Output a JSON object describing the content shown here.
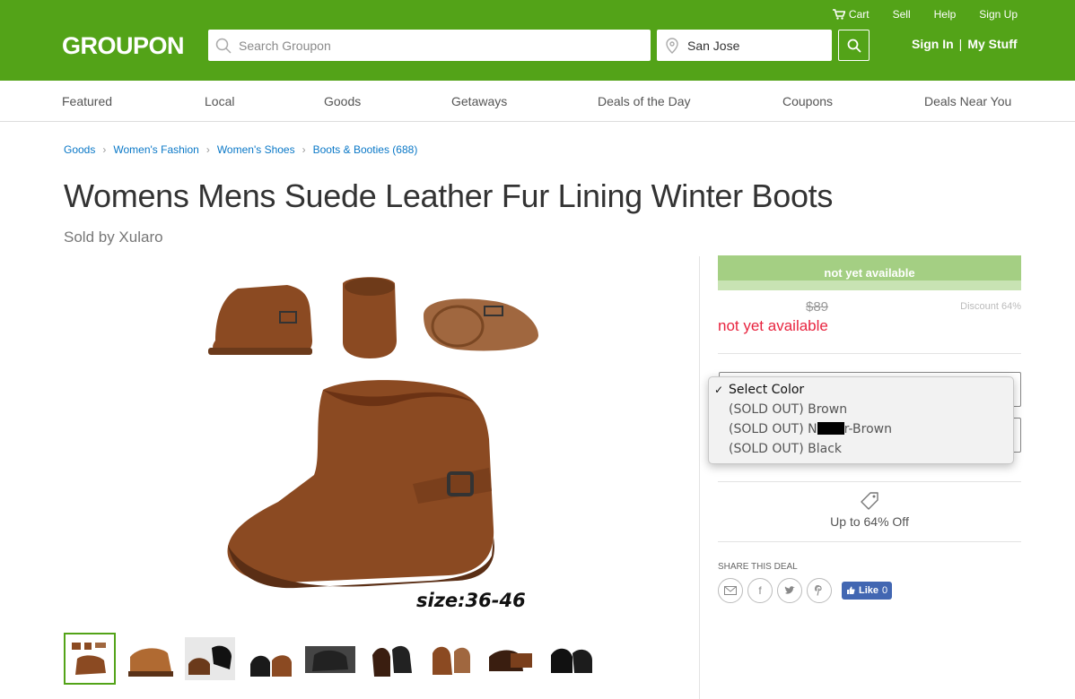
{
  "header": {
    "logo": "GROUPON",
    "top_links": {
      "cart": "Cart",
      "sell": "Sell",
      "help": "Help",
      "signup": "Sign Up"
    },
    "search_placeholder": "Search Groupon",
    "location": "San Jose",
    "signin": "Sign In",
    "separator": "|",
    "mystuff": "My Stuff"
  },
  "nav": {
    "items": [
      "Featured",
      "Local",
      "Goods",
      "Getaways",
      "Deals of the Day",
      "Coupons",
      "Deals Near You"
    ]
  },
  "breadcrumb": [
    "Goods",
    "Women's Fashion",
    "Women's Shoes",
    "Boots & Booties (688)"
  ],
  "product": {
    "title": "Womens Mens Suede Leather Fur Lining Winter Boots",
    "seller": "Sold by Xularo",
    "caption": "size:36-46"
  },
  "pricing": {
    "status_bar": "not yet available",
    "original_price": "$89",
    "discount": "Discount 64%",
    "price_status": "not yet available"
  },
  "color_dropdown": {
    "check": "✓",
    "options": [
      "Select Color",
      "(SOLD OUT) Brown",
      "(SOLD OUT) N",
      "(SOLD OUT) Black"
    ],
    "option3_suffix": "r-Brown",
    "selected_index": 0
  },
  "offer": {
    "text": "Up to 64% Off"
  },
  "share": {
    "label": "SHARE THIS DEAL",
    "icons": [
      "email-icon",
      "facebook-icon",
      "twitter-icon",
      "pinterest-icon"
    ],
    "fb_like": "Like",
    "fb_count": "0"
  },
  "colors": {
    "brand_green": "#53a318",
    "link_blue": "#0a78c7",
    "alert_red": "#e8243f",
    "boot_brown": "#8b4a22"
  },
  "thumbnails_count": 9
}
